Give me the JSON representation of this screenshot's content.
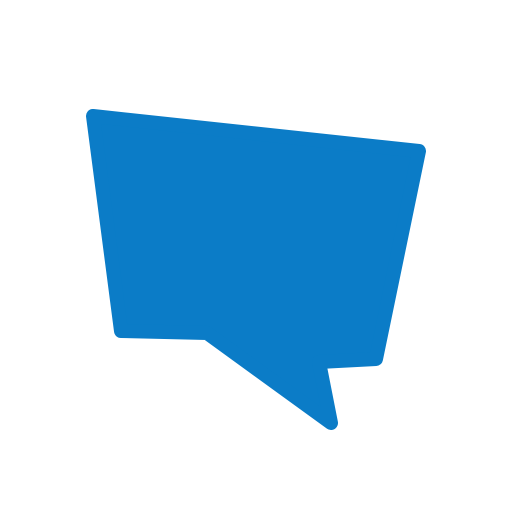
{
  "icon": {
    "name": "speech-bubble-icon",
    "color": "#0b7cc7",
    "background": "#ffffff"
  }
}
